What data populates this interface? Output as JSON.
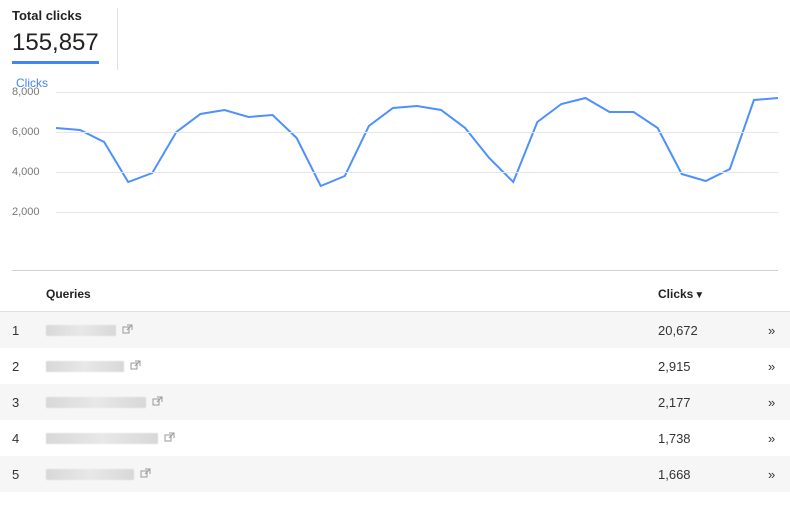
{
  "metric": {
    "label": "Total clicks",
    "value": "155,857"
  },
  "chart": {
    "legend": "Clicks"
  },
  "chart_data": {
    "type": "line",
    "title": "",
    "xlabel": "",
    "ylabel": "Clicks",
    "ylim": [
      0,
      8000
    ],
    "yticks": [
      2000,
      4000,
      6000,
      8000
    ],
    "ytick_labels": [
      "2,000",
      "4,000",
      "6,000",
      "8,000"
    ],
    "x": [
      0,
      1,
      2,
      3,
      4,
      5,
      6,
      7,
      8,
      9,
      10,
      11,
      12,
      13,
      14,
      15,
      16,
      17,
      18,
      19,
      20,
      21,
      22,
      23,
      24,
      25,
      26,
      27,
      28,
      29,
      30
    ],
    "values": [
      6200,
      6100,
      5500,
      3500,
      3950,
      6000,
      6900,
      7100,
      6750,
      6850,
      5700,
      3300,
      3800,
      6300,
      7200,
      7300,
      7100,
      6200,
      4700,
      3500,
      6500,
      7400,
      7700,
      7000,
      7000,
      6200,
      3900,
      3550,
      4150,
      7600,
      7700
    ],
    "series_color": "#4d90fe"
  },
  "table": {
    "headers": {
      "index": "",
      "queries": "Queries",
      "clicks": "Clicks",
      "sort_indicator": "▼"
    },
    "rows": [
      {
        "index": "1",
        "redacted_width": 70,
        "clicks": "20,672"
      },
      {
        "index": "2",
        "redacted_width": 78,
        "clicks": "2,915"
      },
      {
        "index": "3",
        "redacted_width": 100,
        "clicks": "2,177"
      },
      {
        "index": "4",
        "redacted_width": 112,
        "clicks": "1,738"
      },
      {
        "index": "5",
        "redacted_width": 88,
        "clicks": "1,668"
      }
    ]
  },
  "icons": {
    "external": "↗",
    "expand": "»"
  }
}
